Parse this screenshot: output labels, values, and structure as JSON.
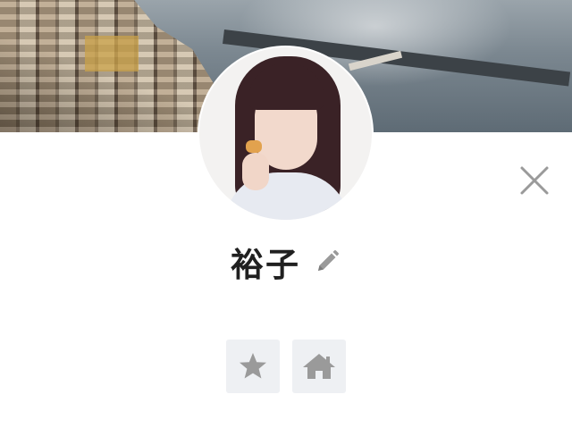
{
  "profile": {
    "name": "裕子",
    "status_message": ""
  },
  "icons": {
    "close": "close-icon",
    "edit": "pencil-icon",
    "favorite": "star-icon",
    "home": "home-icon"
  },
  "colors": {
    "icon_gray": "#9a9a9a",
    "action_bg": "#eef0f3",
    "name_text": "#202020"
  }
}
